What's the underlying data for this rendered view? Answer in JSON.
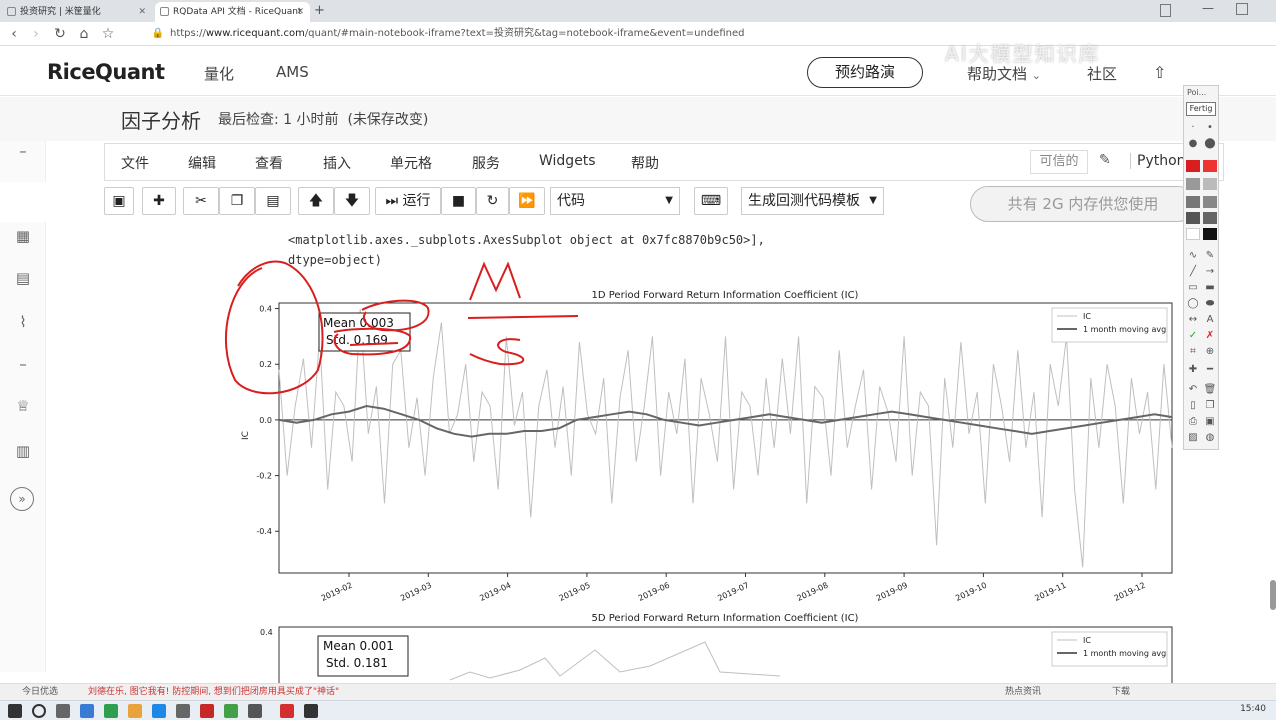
{
  "browser": {
    "tabs": [
      {
        "title": "投资研究 | 米筐量化"
      },
      {
        "title": "RQData API 文档 - RiceQuant"
      }
    ],
    "new_tab": "+",
    "url_prefix": "https://",
    "url_host": "www.ricequant.com",
    "url_rest": "/quant/#main-notebook-iframe?text=投资研究&tag=notebook-iframe&event=undefined"
  },
  "site": {
    "logo": "RiceQuant",
    "nav": [
      "量化",
      "AMS"
    ],
    "demo_button": "预约路演",
    "help": "帮助文档",
    "community": "社区"
  },
  "notebook": {
    "title": "因子分析",
    "checkpoint": "最后检查: 1 小时前",
    "unsaved": "(未保存改变)",
    "menu": [
      "文件",
      "编辑",
      "查看",
      "插入",
      "单元格",
      "服务",
      "Widgets",
      "帮助"
    ],
    "trusted": "可信的",
    "kernel": "Python",
    "run_label": "运行",
    "cell_type": "代码",
    "template": "生成回测代码模板",
    "memory": "共有 2G 内存供您使用",
    "output_lines": [
      "<matplotlib.axes._subplots.AxesSubplot object at 0x7fc8870b9c50>],",
      "dtype=object)"
    ]
  },
  "palette": {
    "title": "Poi...",
    "button": "Fertig"
  },
  "watermark": "AI大模型知识库",
  "news": {
    "left": "今日优选",
    "headline": "刘德在乐, 图它我有! 防控期间, 想到们把闭房用具买成了\"神话\"",
    "right1": "热点资讯",
    "right2": "下载"
  },
  "clock": "15:40",
  "colors": {
    "accent_red": "#d81e1e",
    "line_ic": "#bfbfbf",
    "line_avg": "#666666"
  },
  "chart_data": [
    {
      "type": "line",
      "title": "1D Period Forward Return Information Coefficient (IC)",
      "ylabel": "IC",
      "ylim": [
        -0.55,
        0.42
      ],
      "yticks": [
        "0.4",
        "0.2",
        "0.0",
        "-0.2",
        "-0.4"
      ],
      "xticks": [
        "2019-02",
        "2019-03",
        "2019-04",
        "2019-05",
        "2019-06",
        "2019-07",
        "2019-08",
        "2019-09",
        "2019-10",
        "2019-11",
        "2019-12"
      ],
      "stats": {
        "mean": "Mean 0.003",
        "std": "Std. 0.169"
      },
      "series": [
        {
          "name": "IC",
          "values": [
            0.18,
            -0.2,
            0.05,
            0.22,
            -0.1,
            0.3,
            -0.25,
            0.1,
            0.05,
            -0.15,
            0.4,
            -0.05,
            0.12,
            -0.3,
            0.2,
            0.25,
            -0.1,
            0.08,
            -0.2,
            0.15,
            0.35,
            -0.05,
            0.02,
            0.2,
            -0.15,
            0.1,
            0.05,
            -0.25,
            0.3,
            -0.02,
            0.1,
            -0.35,
            0.05,
            0.18,
            -0.1,
            0.12,
            -0.2,
            0.28,
            0.02,
            -0.05,
            0.15,
            -0.3,
            0.08,
            0.25,
            -0.15,
            0.05,
            0.3,
            -0.2,
            0.1,
            -0.05,
            0.22,
            -0.3,
            0.15,
            0.02,
            -0.15,
            0.3,
            -0.25,
            0.1,
            0.05,
            -0.2,
            0.15,
            -0.1,
            0.22,
            -0.05,
            0.3,
            -0.3,
            0.12,
            0.08,
            -0.2,
            0.25,
            -0.1,
            0.05,
            0.18,
            -0.25,
            0.12,
            0.03,
            -0.15,
            0.3,
            -0.2,
            0.1,
            0.05,
            -0.45,
            0.15,
            -0.1,
            0.28,
            -0.05,
            0.1,
            -0.3,
            0.2,
            0.05,
            -0.15,
            0.25,
            -0.1,
            0.1,
            -0.35,
            0.2,
            0.05,
            0.3,
            -0.25,
            -0.53,
            0.15,
            -0.1,
            0.2,
            0.05,
            -0.3,
            0.15,
            -0.05,
            0.1,
            -0.25,
            0.2,
            -0.1
          ]
        },
        {
          "name": "1 month moving avg",
          "values": [
            0.0,
            -0.01,
            0.0,
            0.02,
            0.03,
            0.05,
            0.04,
            0.02,
            0.0,
            -0.03,
            -0.05,
            -0.06,
            -0.05,
            -0.05,
            -0.04,
            -0.04,
            -0.03,
            0.0,
            0.01,
            0.02,
            0.03,
            0.02,
            0.0,
            -0.01,
            -0.02,
            -0.01,
            0.0,
            0.01,
            0.02,
            0.01,
            0.0,
            -0.01,
            0.0,
            0.01,
            0.02,
            0.03,
            0.02,
            0.01,
            0.0,
            -0.01,
            -0.02,
            -0.03,
            -0.04,
            -0.05,
            -0.04,
            -0.03,
            -0.02,
            -0.01,
            0.0,
            0.01,
            0.02,
            0.01
          ]
        }
      ]
    },
    {
      "type": "line",
      "title": "5D Period Forward Return Information Coefficient (IC)",
      "ylabel": "IC",
      "yticks": [
        "0.4"
      ],
      "stats": {
        "mean": "Mean 0.001",
        "std": "Std. 0.181"
      },
      "series": [
        {
          "name": "IC"
        },
        {
          "name": "1 month moving avg"
        }
      ]
    }
  ]
}
